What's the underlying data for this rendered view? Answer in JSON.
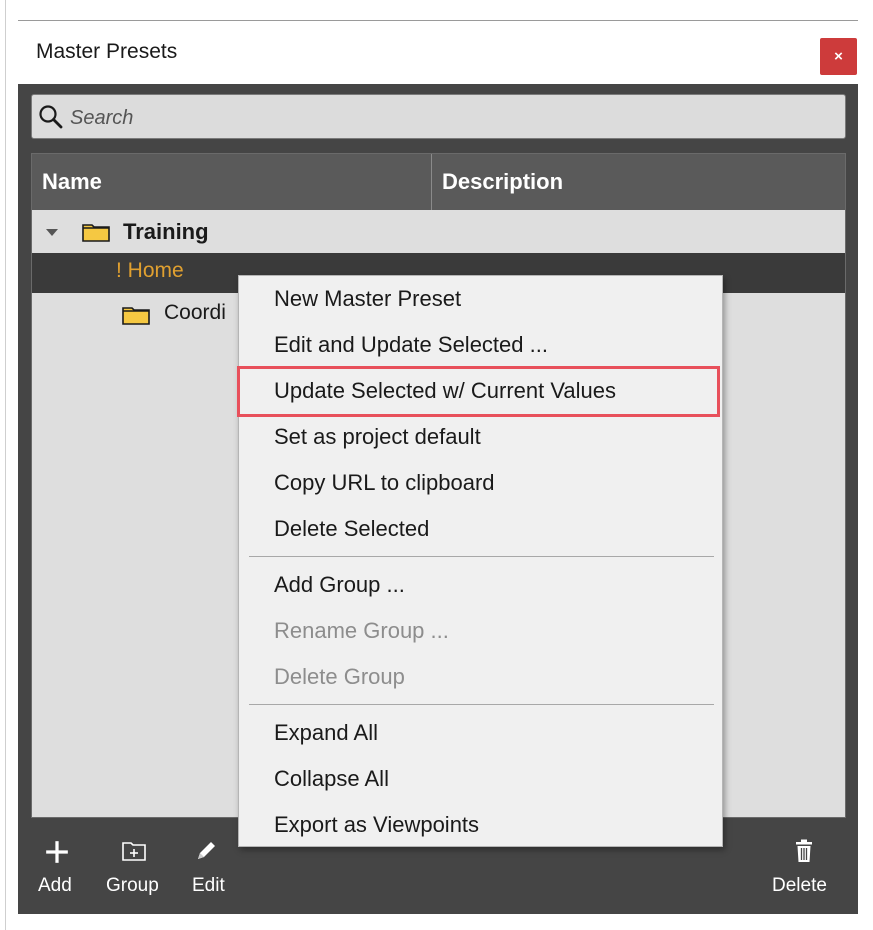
{
  "panel": {
    "title": "Master Presets",
    "close_label": "×"
  },
  "search": {
    "placeholder": "Search"
  },
  "tree": {
    "columns": [
      "Name",
      "Description"
    ],
    "rows": [
      {
        "label": "Training",
        "type": "group",
        "expanded": true
      },
      {
        "label": "! Home",
        "type": "preset",
        "selected": true
      },
      {
        "label": "Coordi",
        "type": "group"
      }
    ]
  },
  "toolbar": {
    "add_label": "Add",
    "group_label": "Group",
    "edit_label": "Edit",
    "delete_label": "Delete"
  },
  "context_menu": {
    "items": [
      {
        "label": "New Master Preset",
        "enabled": true
      },
      {
        "label": "Edit and Update Selected ...",
        "enabled": true
      },
      {
        "label": "Update Selected w/ Current Values",
        "enabled": true,
        "highlighted": true
      },
      {
        "label": "Set as project default",
        "enabled": true
      },
      {
        "label": "Copy URL to clipboard",
        "enabled": true
      },
      {
        "label": "Delete Selected",
        "enabled": true
      },
      {
        "label": "Add Group ...",
        "enabled": true
      },
      {
        "label": "Rename Group ...",
        "enabled": false
      },
      {
        "label": "Delete Group",
        "enabled": false
      },
      {
        "label": "Expand All",
        "enabled": true
      },
      {
        "label": "Collapse All",
        "enabled": true
      },
      {
        "label": "Export as Viewpoints",
        "enabled": true
      }
    ]
  },
  "colors": {
    "close_button": "#cd3b3b",
    "selected_row": "#3a3a3a",
    "selected_text": "#e0a030",
    "highlight_border": "#e8505b",
    "folder": "#f5c842"
  },
  "icons": [
    "search-icon",
    "folder-icon",
    "plus-icon",
    "group-icon",
    "pencil-icon",
    "trash-icon",
    "expand-arrow-icon"
  ]
}
